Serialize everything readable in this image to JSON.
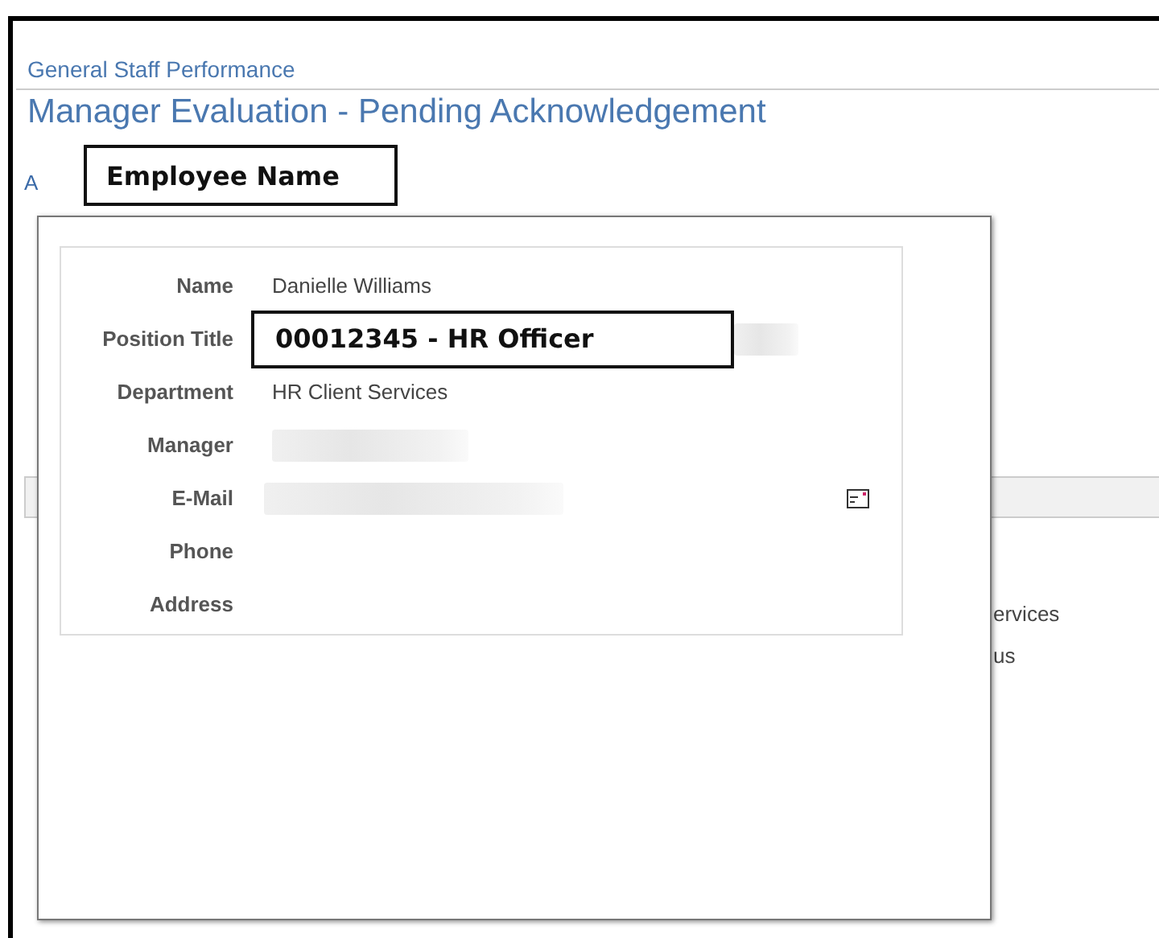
{
  "breadcrumb": "General Staff Performance",
  "page_title": "Manager Evaluation - Pending Acknowledgement",
  "background": {
    "link_fragment": "A",
    "fragments": [
      "ervices",
      "us"
    ]
  },
  "callout": "Employee Name",
  "popup": {
    "fields": [
      {
        "label": "Name",
        "kind": "text",
        "value": "Danielle Williams"
      },
      {
        "label": "Position Title",
        "kind": "highlighted",
        "value": "00012345 - HR Officer"
      },
      {
        "label": "Department",
        "kind": "text",
        "value": "HR Client Services"
      },
      {
        "label": "Manager",
        "kind": "redacted"
      },
      {
        "label": "E-Mail",
        "kind": "redacted",
        "mail_icon": true
      },
      {
        "label": "Phone",
        "kind": "empty"
      },
      {
        "label": "Address",
        "kind": "empty"
      }
    ]
  }
}
